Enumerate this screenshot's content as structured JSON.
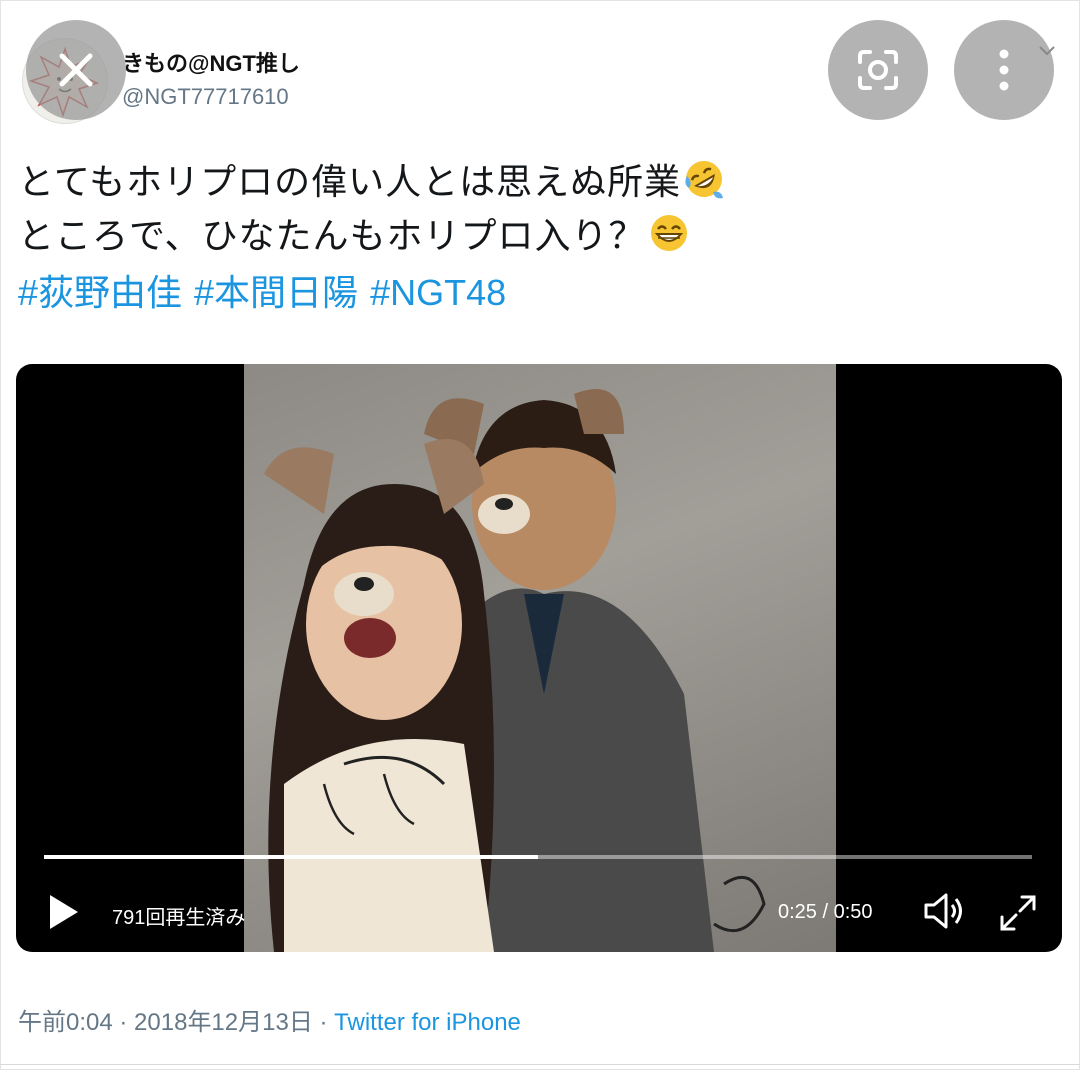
{
  "header": {
    "display_name": "きもの@NGT推し",
    "handle": "@NGT77717610",
    "close_icon": "close-icon",
    "lens_icon": "visual-search-icon",
    "more_icon": "more-vertical-icon",
    "chevron_icon": "chevron-down-icon"
  },
  "tweet": {
    "line1": "とてもホリプロの偉い人とは思えぬ所業",
    "line1_emoji": "rolling-on-floor-laughing-emoji",
    "line2": "ところで、ひなたんもホリプロ入り？",
    "line2_emoji": "grinning-face-emoji",
    "hashtags": [
      "#荻野由佳",
      "#本間日陽",
      "#NGT48"
    ]
  },
  "video": {
    "views": "791回再生済み",
    "time": "0:25 / 0:50",
    "progress": 0.5,
    "play_icon": "play-icon",
    "volume_icon": "volume-icon",
    "fullscreen_icon": "fullscreen-icon"
  },
  "footer": {
    "time": "午前0:04",
    "sep1": " · ",
    "date": "2018年12月13日",
    "sep2": " · ",
    "source": "Twitter for iPhone"
  },
  "colors": {
    "link": "#1b95e0",
    "secondary": "#657786",
    "video_bg": "#000000"
  }
}
